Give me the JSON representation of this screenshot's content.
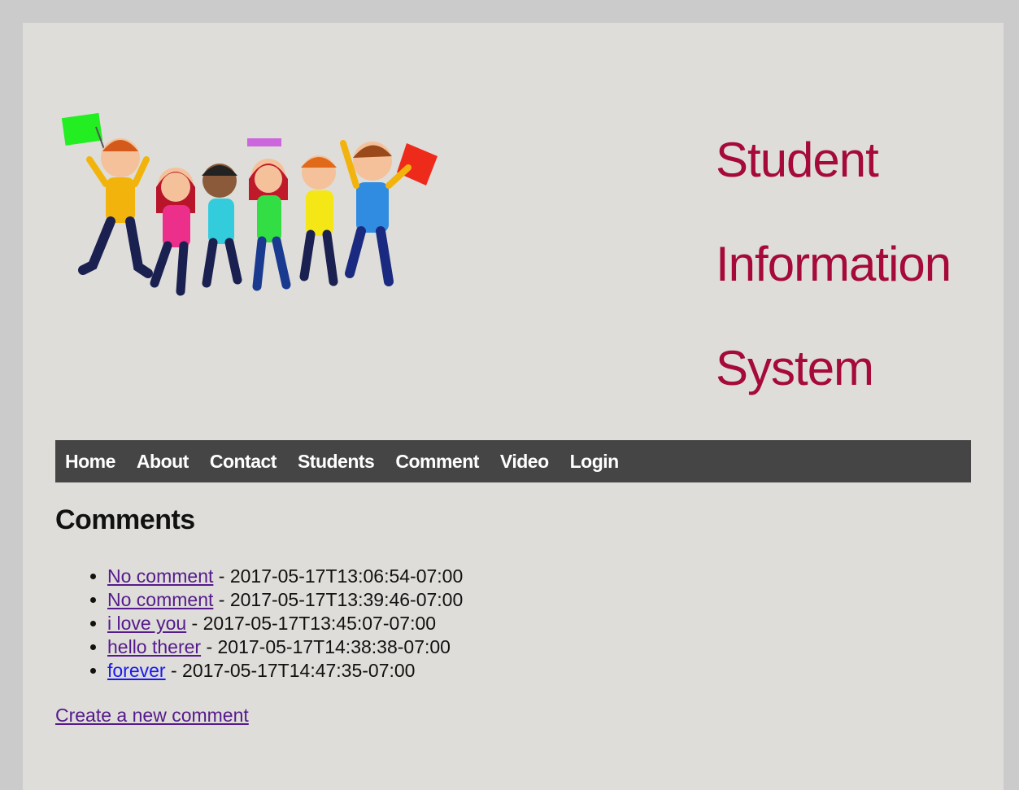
{
  "header": {
    "title_lines": [
      "Student",
      "Information",
      "System"
    ],
    "title_color": "#a50a3a"
  },
  "nav": {
    "items": [
      "Home",
      "About",
      "Contact",
      "Students",
      "Comment",
      "Video",
      "Login"
    ],
    "background": "#454545"
  },
  "main": {
    "heading": "Comments",
    "comments": [
      {
        "text": "No comment",
        "timestamp": " - 2017-05-17T13:06:54-07:00",
        "visited": true
      },
      {
        "text": "No comment",
        "timestamp": " - 2017-05-17T13:39:46-07:00",
        "visited": true
      },
      {
        "text": "i love you",
        "timestamp": " - 2017-05-17T13:45:07-07:00",
        "visited": true
      },
      {
        "text": "hello therer",
        "timestamp": " - 2017-05-17T14:38:38-07:00",
        "visited": true
      },
      {
        "text": "forever",
        "timestamp": " - 2017-05-17T14:47:35-07:00",
        "visited": false
      }
    ],
    "create_link": "Create a new comment"
  }
}
